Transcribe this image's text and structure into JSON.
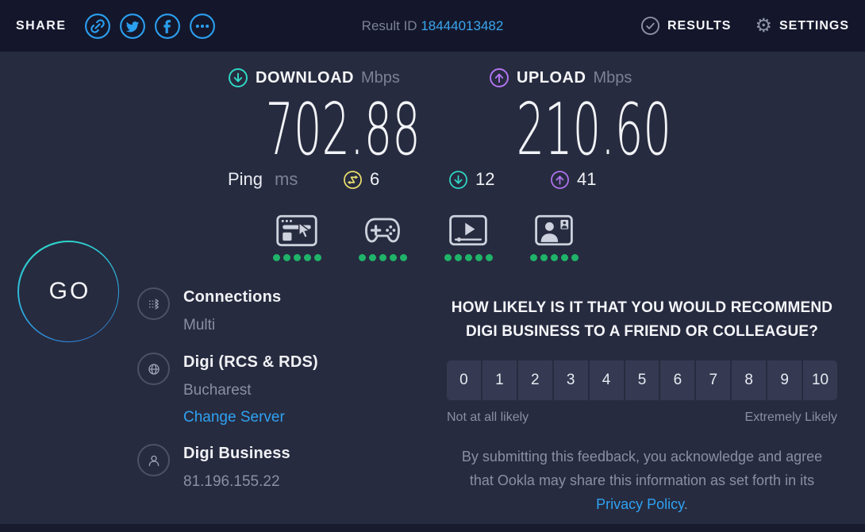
{
  "colors": {
    "accent_blue": "#2ea2f2",
    "teal": "#2fd9c6",
    "purple": "#b175f1",
    "yellow": "#ece06c",
    "green": "#1fb469"
  },
  "header": {
    "share_label": "SHARE",
    "share_icons": [
      "link-icon",
      "twitter-icon",
      "facebook-icon",
      "more-icon"
    ],
    "result_id_label": "Result ID",
    "result_id_value": "18444013482",
    "results_label": "RESULTS",
    "settings_label": "SETTINGS",
    "gear_glyph": "⚙"
  },
  "speed": {
    "download_label": "DOWNLOAD",
    "download_unit": "Mbps",
    "download_value": "702.88",
    "upload_label": "UPLOAD",
    "upload_unit": "Mbps",
    "upload_value": "210.60"
  },
  "ping": {
    "label": "Ping",
    "unit": "ms",
    "idle_value": "6",
    "download_value": "12",
    "upload_value": "41"
  },
  "activities": [
    {
      "name": "browsing",
      "rating": 5
    },
    {
      "name": "gaming",
      "rating": 5
    },
    {
      "name": "streaming",
      "rating": 5
    },
    {
      "name": "video-chat",
      "rating": 5
    }
  ],
  "go_button_label": "GO",
  "connection": {
    "connections_title": "Connections",
    "connections_value": "Multi",
    "server_title": "Digi (RCS & RDS)",
    "server_location": "Bucharest",
    "change_server_label": "Change Server",
    "isp_title": "Digi Business",
    "isp_ip": "81.196.155.22"
  },
  "survey": {
    "question_line1": "HOW LIKELY IS IT THAT YOU WOULD RECOMMEND",
    "question_line2": "DIGI BUSINESS TO A FRIEND OR COLLEAGUE?",
    "scale": [
      "0",
      "1",
      "2",
      "3",
      "4",
      "5",
      "6",
      "7",
      "8",
      "9",
      "10"
    ],
    "min_label": "Not at all likely",
    "max_label": "Extremely Likely",
    "disclaimer_before": "By submitting this feedback, you acknowledge and agree that Ookla may share this information as set forth in its ",
    "privacy_link_label": "Privacy Policy",
    "disclaimer_after": "."
  }
}
